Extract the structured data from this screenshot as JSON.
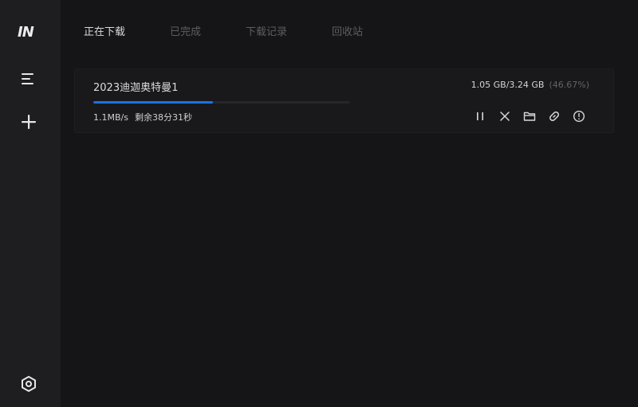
{
  "app": {
    "logo": "IN"
  },
  "sidebar": {
    "items": [
      {
        "name": "menu",
        "icon": "menu-icon"
      },
      {
        "name": "add",
        "icon": "plus-icon"
      },
      {
        "name": "settings",
        "icon": "hexagon-settings-icon"
      }
    ]
  },
  "tabs": [
    {
      "label": "正在下载",
      "active": true
    },
    {
      "label": "已完成",
      "active": false
    },
    {
      "label": "下载记录",
      "active": false
    },
    {
      "label": "回收站",
      "active": false
    }
  ],
  "task": {
    "name": "2023迪迦奥特曼1",
    "size": "1.05 GB/3.24 GB",
    "percent_label": "(46.67%)",
    "progress": 0.4667,
    "speed": "1.1MB/s",
    "remaining": "剩余38分31秒",
    "actions": [
      "pause-icon",
      "close-icon",
      "folder-icon",
      "link-icon",
      "info-icon"
    ]
  },
  "colors": {
    "accent": "#1a72e3",
    "background": "#151517",
    "sidebar": "#1e1e21"
  }
}
